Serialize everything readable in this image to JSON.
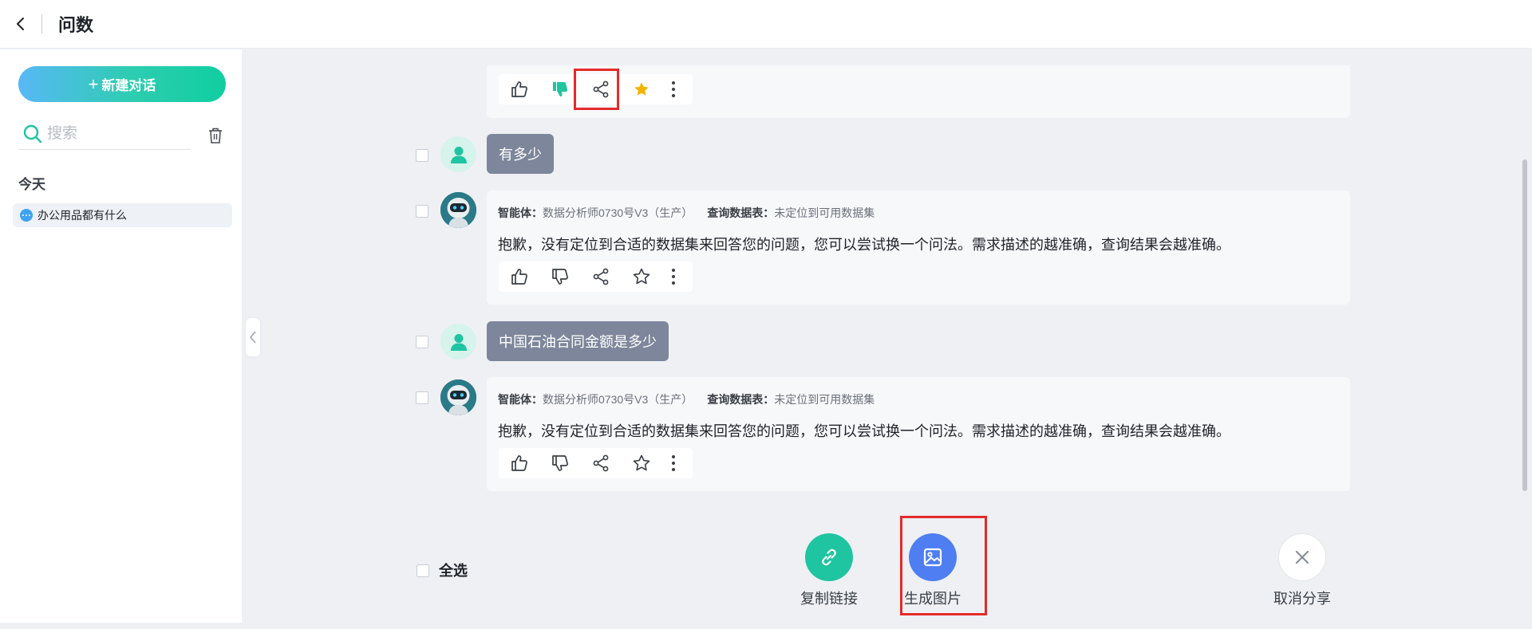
{
  "header": {
    "title": "问数"
  },
  "sidebar": {
    "new_chat_label": "新建对话",
    "search_placeholder": "搜索",
    "section_today": "今天",
    "history": [
      {
        "label": "办公用品都有什么"
      }
    ]
  },
  "messages": [
    {
      "type": "user",
      "text": "有多少"
    },
    {
      "type": "bot",
      "agent_label": "智能体：",
      "agent_value": "数据分析师0730号V3（生产）",
      "table_label": "查询数据表：",
      "table_value": "未定位到可用数据集",
      "answer": "抱歉，没有定位到合适的数据集来回答您的问题，您可以尝试换一个问法。需求描述的越准确，查询结果会越准确。"
    },
    {
      "type": "user",
      "text": "中国石油合同金额是多少"
    },
    {
      "type": "bot",
      "agent_label": "智能体：",
      "agent_value": "数据分析师0730号V3（生产）",
      "table_label": "查询数据表：",
      "table_value": "未定位到可用数据集",
      "answer": "抱歉，没有定位到合适的数据集来回答您的问题，您可以尝试换一个问法。需求描述的越准确，查询结果会越准确。"
    }
  ],
  "share_bar": {
    "select_all": "全选",
    "copy_link": "复制链接",
    "generate_image": "生成图片",
    "cancel_share": "取消分享"
  },
  "colors": {
    "accent_teal": "#1fc4a0",
    "accent_blue": "#4e7ef2",
    "star_yellow": "#f5b400",
    "highlight_red": "#e42a2a",
    "user_bubble": "#7d869a"
  }
}
